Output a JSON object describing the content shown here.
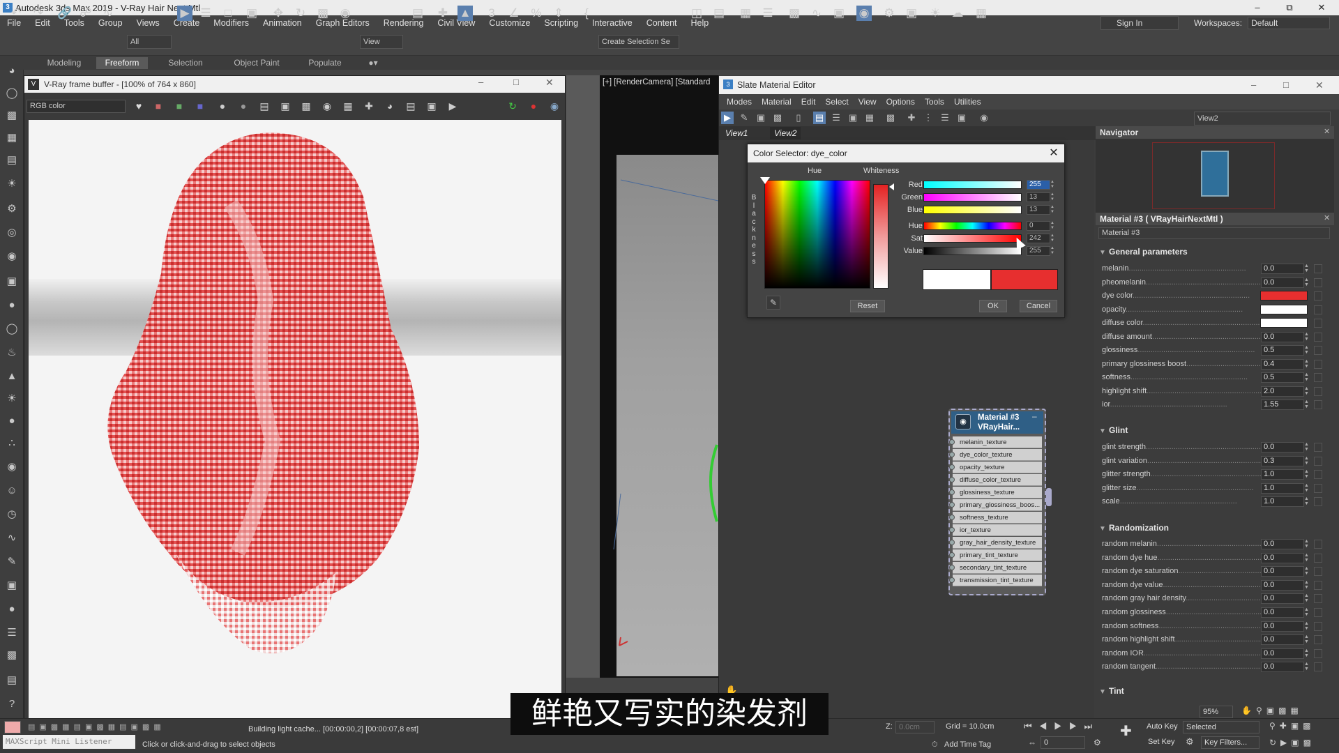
{
  "window": {
    "title": "Autodesk 3ds Max 2019 - V-Ray Hair Next Mtl",
    "app_icon": "3"
  },
  "menu": [
    "File",
    "Edit",
    "Tools",
    "Group",
    "Views",
    "Create",
    "Modifiers",
    "Animation",
    "Graph Editors",
    "Rendering",
    "Civil View",
    "Customize",
    "Scripting",
    "Interactive",
    "Content",
    "Help"
  ],
  "account": {
    "sign_in": "Sign In",
    "workspaces_label": "Workspaces:",
    "workspace": "Default"
  },
  "toolbar": {
    "filter": "All",
    "ref_coord": "View",
    "selection_set": "Create Selection Se"
  },
  "ribbon": [
    "Modeling",
    "Freeform",
    "Selection",
    "Object Paint",
    "Populate"
  ],
  "vfb": {
    "title": "V-Ray frame buffer - [100% of 764 x 860]",
    "channel": "RGB color"
  },
  "viewport": {
    "label": "[+] [RenderCamera] [Standard"
  },
  "sme": {
    "title": "Slate Material Editor",
    "menu": [
      "Modes",
      "Material",
      "Edit",
      "Select",
      "View",
      "Options",
      "Tools",
      "Utilities"
    ],
    "tabs": [
      "View1",
      "View2"
    ],
    "view_dropdown": "View2",
    "navigator": "Navigator"
  },
  "color_selector": {
    "title": "Color Selector: dye_color",
    "hue_label": "Hue",
    "whiteness_label": "Whiteness",
    "blackness_label": [
      "B",
      "l",
      "a",
      "c",
      "k",
      "n",
      "e",
      "s",
      "s"
    ],
    "red": {
      "label": "Red:",
      "value": "255"
    },
    "green": {
      "label": "Green:",
      "value": "13"
    },
    "blue": {
      "label": "Blue:",
      "value": "13"
    },
    "hue": {
      "label": "Hue:",
      "value": "0"
    },
    "sat": {
      "label": "Sat:",
      "value": "242"
    },
    "val": {
      "label": "Value:",
      "value": "255"
    },
    "reset": "Reset",
    "ok": "OK",
    "cancel": "Cancel",
    "old_color": "#ffffff",
    "new_color": "#e72f2f"
  },
  "node": {
    "title_line1": "Material #3",
    "title_line2": "VRayHair...",
    "slots": [
      "melanin_texture",
      "dye_color_texture",
      "opacity_texture",
      "diffuse_color_texture",
      "glossiness_texture",
      "primary_glossiness_boos...",
      "softness_texture",
      "ior_texture",
      "gray_hair_density_texture",
      "primary_tint_texture",
      "secondary_tint_texture",
      "transmission_tint_texture"
    ]
  },
  "params": {
    "header": "Material #3 ( VRayHairNextMtl )",
    "name": "Material #3",
    "general_title": "General parameters",
    "general": [
      {
        "label": "melanin",
        "value": "0.0"
      },
      {
        "label": "pheomelanin",
        "value": "0.0"
      },
      {
        "label": "dye color",
        "swatch": "#e72f2f"
      },
      {
        "label": "opacity",
        "swatch": "#ffffff"
      },
      {
        "label": "diffuse color",
        "swatch": "#ffffff"
      },
      {
        "label": "diffuse amount",
        "value": "0.0"
      },
      {
        "label": "glossiness",
        "value": "0.5"
      },
      {
        "label": "primary glossiness boost",
        "value": "0.4"
      },
      {
        "label": "softness",
        "value": "0.5"
      },
      {
        "label": "highlight shift",
        "value": "2.0"
      },
      {
        "label": "ior",
        "value": "1.55"
      }
    ],
    "glint_title": "Glint",
    "glint": [
      {
        "label": "glint strength",
        "value": "0.0"
      },
      {
        "label": "glint variation",
        "value": "0.3"
      },
      {
        "label": "glitter strength",
        "value": "1.0"
      },
      {
        "label": "glitter size",
        "value": "1.0"
      },
      {
        "label": "scale",
        "value": "1.0"
      }
    ],
    "random_title": "Randomization",
    "random": [
      {
        "label": "random melanin",
        "value": "0.0"
      },
      {
        "label": "random dye hue",
        "value": "0.0"
      },
      {
        "label": "random dye saturation",
        "value": "0.0"
      },
      {
        "label": "random dye value",
        "value": "0.0"
      },
      {
        "label": "random gray hair density",
        "value": "0.0"
      },
      {
        "label": "random glossiness",
        "value": "0.0"
      },
      {
        "label": "random softness",
        "value": "0.0"
      },
      {
        "label": "random highlight shift",
        "value": "0.0"
      },
      {
        "label": "random IOR",
        "value": "0.0"
      },
      {
        "label": "random tangent",
        "value": "0.0"
      }
    ],
    "tint_title": "Tint"
  },
  "status": {
    "maxscript": "MAXScript Mini Listener",
    "message": "Click or click-and-drag to select objects",
    "progress": "Building light cache... [00:00:00,2] [00:00:07,8 est]",
    "z_label": "Z:",
    "z_value": "0.0cm",
    "grid": "Grid = 10.0cm",
    "add_time_tag": "Add Time Tag",
    "auto_key": "Auto Key",
    "selected": "Selected",
    "set_key": "Set Key",
    "key_filters": "Key Filters...",
    "frame": "0",
    "zoom": "95%"
  },
  "subtitle": "鲜艳又写实的染发剂"
}
